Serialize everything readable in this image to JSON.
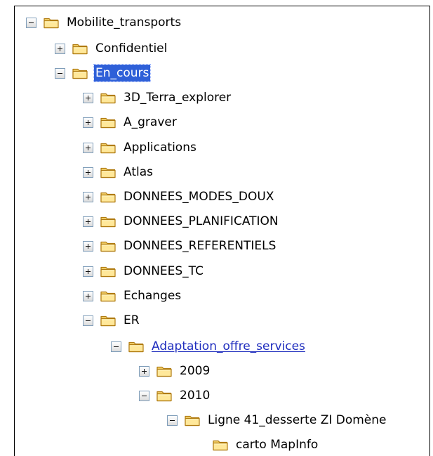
{
  "tree": {
    "items": [
      {
        "label": "Mobilite_transports",
        "state": "expanded"
      },
      {
        "label": "Confidentiel",
        "state": "collapsed"
      },
      {
        "label": "En_cours",
        "state": "expanded",
        "selected": true
      },
      {
        "label": "3D_Terra_explorer",
        "state": "collapsed"
      },
      {
        "label": "A_graver",
        "state": "collapsed"
      },
      {
        "label": "Applications",
        "state": "collapsed"
      },
      {
        "label": "Atlas",
        "state": "collapsed"
      },
      {
        "label": "DONNEES_MODES_DOUX",
        "state": "collapsed"
      },
      {
        "label": "DONNEES_PLANIFICATION",
        "state": "collapsed"
      },
      {
        "label": "DONNEES_REFERENTIELS",
        "state": "collapsed"
      },
      {
        "label": "DONNEES_TC",
        "state": "collapsed"
      },
      {
        "label": "Echanges",
        "state": "collapsed"
      },
      {
        "label": "ER",
        "state": "expanded"
      },
      {
        "label": "Adaptation_offre_services",
        "state": "expanded",
        "link": true
      },
      {
        "label": "2009",
        "state": "collapsed"
      },
      {
        "label": "2010",
        "state": "expanded"
      },
      {
        "label": "Ligne 41_desserte ZI Domène",
        "state": "expanded"
      },
      {
        "label": "carto MapInfo",
        "state": "leaf"
      }
    ]
  },
  "colors": {
    "selection": "#2f60d8",
    "link": "#1f2dbe",
    "folder_fill": "#f6d46e",
    "folder_stroke": "#b07b11",
    "toggle_border": "#7f9db9"
  },
  "icons": {
    "folder": "folder-icon",
    "expand": "plus-icon",
    "collapse": "minus-icon"
  }
}
